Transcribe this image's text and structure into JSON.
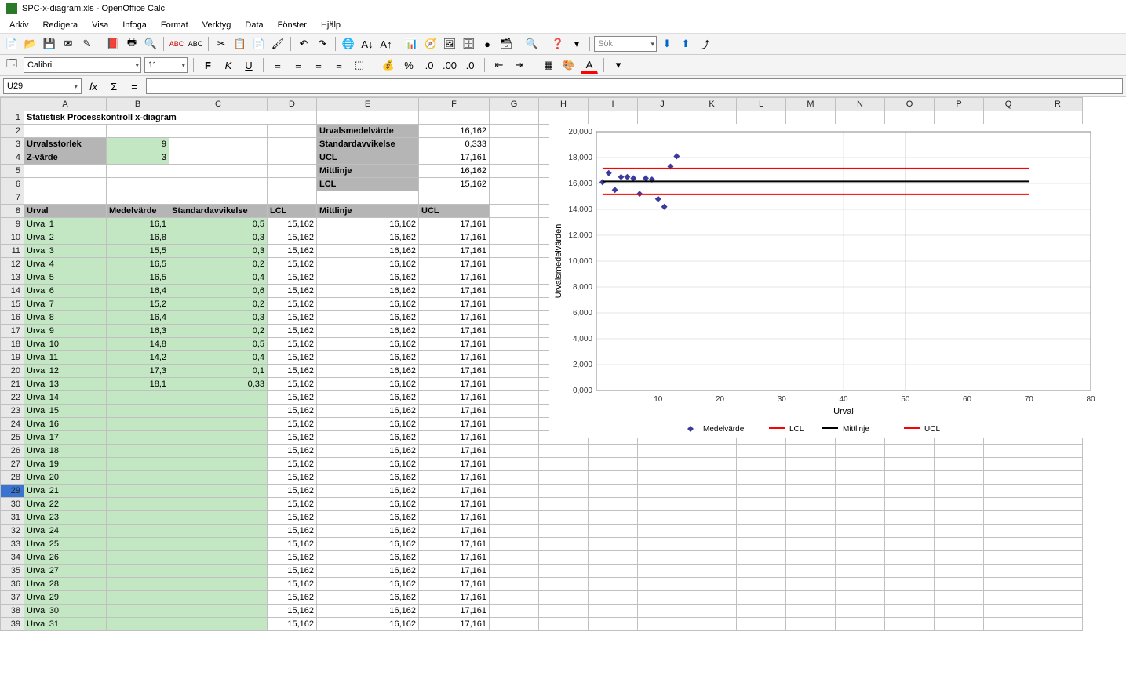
{
  "app": {
    "title": "SPC-x-diagram.xls - OpenOffice Calc"
  },
  "menu": {
    "arkiv": "Arkiv",
    "redigera": "Redigera",
    "visa": "Visa",
    "infoga": "Infoga",
    "format": "Format",
    "verktyg": "Verktyg",
    "data": "Data",
    "fonster": "Fönster",
    "hjalp": "Hjälp"
  },
  "font": {
    "name": "Calibri",
    "size": "11"
  },
  "search_placeholder": "Sök",
  "cell_ref": "U29",
  "formula": "",
  "colHeaders": [
    "A",
    "B",
    "C",
    "D",
    "E",
    "F",
    "G",
    "H",
    "I",
    "J",
    "K",
    "L",
    "M",
    "N",
    "O",
    "P",
    "Q",
    "R"
  ],
  "titleRow": "Statistisk Processkontroll x-diagram",
  "params": {
    "urvalsstorlek_label": "Urvalsstorlek",
    "urvalsstorlek_val": "9",
    "zvarde_label": "Z-värde",
    "zvarde_val": "3",
    "urvalsmedel_label": "Urvalsmedelvärde",
    "urvalsmedel_val": "16,162",
    "stdav_label": "Standardavvikelse",
    "stdav_val": "0,333",
    "ucl_label": "UCL",
    "ucl_val": "17,161",
    "mitt_label": "Mittlinje",
    "mitt_val": "16,162",
    "lcl_label": "LCL",
    "lcl_val": "15,162"
  },
  "headers": {
    "urval": "Urval",
    "medel": "Medelvärde",
    "std": "Standardavvikelse",
    "lcl": "LCL",
    "mitt": "Mittlinje",
    "ucl": "UCL"
  },
  "rows": [
    {
      "n": "Urval 1",
      "m": "16,1",
      "s": "0,5",
      "lcl": "15,162",
      "mitt": "16,162",
      "ucl": "17,161"
    },
    {
      "n": "Urval 2",
      "m": "16,8",
      "s": "0,3",
      "lcl": "15,162",
      "mitt": "16,162",
      "ucl": "17,161"
    },
    {
      "n": "Urval 3",
      "m": "15,5",
      "s": "0,3",
      "lcl": "15,162",
      "mitt": "16,162",
      "ucl": "17,161"
    },
    {
      "n": "Urval 4",
      "m": "16,5",
      "s": "0,2",
      "lcl": "15,162",
      "mitt": "16,162",
      "ucl": "17,161"
    },
    {
      "n": "Urval 5",
      "m": "16,5",
      "s": "0,4",
      "lcl": "15,162",
      "mitt": "16,162",
      "ucl": "17,161"
    },
    {
      "n": "Urval 6",
      "m": "16,4",
      "s": "0,6",
      "lcl": "15,162",
      "mitt": "16,162",
      "ucl": "17,161"
    },
    {
      "n": "Urval 7",
      "m": "15,2",
      "s": "0,2",
      "lcl": "15,162",
      "mitt": "16,162",
      "ucl": "17,161"
    },
    {
      "n": "Urval 8",
      "m": "16,4",
      "s": "0,3",
      "lcl": "15,162",
      "mitt": "16,162",
      "ucl": "17,161"
    },
    {
      "n": "Urval 9",
      "m": "16,3",
      "s": "0,2",
      "lcl": "15,162",
      "mitt": "16,162",
      "ucl": "17,161"
    },
    {
      "n": "Urval 10",
      "m": "14,8",
      "s": "0,5",
      "lcl": "15,162",
      "mitt": "16,162",
      "ucl": "17,161"
    },
    {
      "n": "Urval 11",
      "m": "14,2",
      "s": "0,4",
      "lcl": "15,162",
      "mitt": "16,162",
      "ucl": "17,161"
    },
    {
      "n": "Urval 12",
      "m": "17,3",
      "s": "0,1",
      "lcl": "15,162",
      "mitt": "16,162",
      "ucl": "17,161"
    },
    {
      "n": "Urval 13",
      "m": "18,1",
      "s": "0,33",
      "lcl": "15,162",
      "mitt": "16,162",
      "ucl": "17,161"
    },
    {
      "n": "Urval 14",
      "m": "",
      "s": "",
      "lcl": "15,162",
      "mitt": "16,162",
      "ucl": "17,161"
    },
    {
      "n": "Urval 15",
      "m": "",
      "s": "",
      "lcl": "15,162",
      "mitt": "16,162",
      "ucl": "17,161"
    },
    {
      "n": "Urval 16",
      "m": "",
      "s": "",
      "lcl": "15,162",
      "mitt": "16,162",
      "ucl": "17,161"
    },
    {
      "n": "Urval 17",
      "m": "",
      "s": "",
      "lcl": "15,162",
      "mitt": "16,162",
      "ucl": "17,161"
    },
    {
      "n": "Urval 18",
      "m": "",
      "s": "",
      "lcl": "15,162",
      "mitt": "16,162",
      "ucl": "17,161"
    },
    {
      "n": "Urval 19",
      "m": "",
      "s": "",
      "lcl": "15,162",
      "mitt": "16,162",
      "ucl": "17,161"
    },
    {
      "n": "Urval 20",
      "m": "",
      "s": "",
      "lcl": "15,162",
      "mitt": "16,162",
      "ucl": "17,161"
    },
    {
      "n": "Urval 21",
      "m": "",
      "s": "",
      "lcl": "15,162",
      "mitt": "16,162",
      "ucl": "17,161"
    },
    {
      "n": "Urval 22",
      "m": "",
      "s": "",
      "lcl": "15,162",
      "mitt": "16,162",
      "ucl": "17,161"
    },
    {
      "n": "Urval 23",
      "m": "",
      "s": "",
      "lcl": "15,162",
      "mitt": "16,162",
      "ucl": "17,161"
    },
    {
      "n": "Urval 24",
      "m": "",
      "s": "",
      "lcl": "15,162",
      "mitt": "16,162",
      "ucl": "17,161"
    },
    {
      "n": "Urval 25",
      "m": "",
      "s": "",
      "lcl": "15,162",
      "mitt": "16,162",
      "ucl": "17,161"
    },
    {
      "n": "Urval 26",
      "m": "",
      "s": "",
      "lcl": "15,162",
      "mitt": "16,162",
      "ucl": "17,161"
    },
    {
      "n": "Urval 27",
      "m": "",
      "s": "",
      "lcl": "15,162",
      "mitt": "16,162",
      "ucl": "17,161"
    },
    {
      "n": "Urval 28",
      "m": "",
      "s": "",
      "lcl": "15,162",
      "mitt": "16,162",
      "ucl": "17,161"
    },
    {
      "n": "Urval 29",
      "m": "",
      "s": "",
      "lcl": "15,162",
      "mitt": "16,162",
      "ucl": "17,161"
    },
    {
      "n": "Urval 30",
      "m": "",
      "s": "",
      "lcl": "15,162",
      "mitt": "16,162",
      "ucl": "17,161"
    },
    {
      "n": "Urval 31",
      "m": "",
      "s": "",
      "lcl": "15,162",
      "mitt": "16,162",
      "ucl": "17,161"
    }
  ],
  "chart_data": {
    "type": "scatter",
    "title": "",
    "xlabel": "Urval",
    "ylabel": "Urvalsmedelvärden",
    "xlim": [
      0,
      80
    ],
    "ylim": [
      0,
      20000
    ],
    "x_ticks": [
      0,
      10,
      20,
      30,
      40,
      50,
      60,
      70,
      80
    ],
    "y_ticks": [
      "0,000",
      "2,000",
      "4,000",
      "6,000",
      "8,000",
      "10,000",
      "12,000",
      "14,000",
      "16,000",
      "18,000",
      "20,000"
    ],
    "series": [
      {
        "name": "Medelvärde",
        "type": "scatter",
        "color": "#3b3b9e",
        "x": [
          1,
          2,
          3,
          4,
          5,
          6,
          7,
          8,
          9,
          10,
          11,
          12,
          13
        ],
        "y": [
          16.1,
          16.8,
          15.5,
          16.5,
          16.5,
          16.4,
          15.2,
          16.4,
          16.3,
          14.8,
          14.2,
          17.3,
          18.1
        ]
      },
      {
        "name": "LCL",
        "type": "line",
        "color": "#ff0000",
        "x": [
          1,
          70
        ],
        "y": [
          15.162,
          15.162
        ]
      },
      {
        "name": "Mittlinje",
        "type": "line",
        "color": "#000000",
        "x": [
          1,
          70
        ],
        "y": [
          16.162,
          16.162
        ]
      },
      {
        "name": "UCL",
        "type": "line",
        "color": "#ff0000",
        "x": [
          1,
          70
        ],
        "y": [
          17.161,
          17.161
        ]
      }
    ],
    "legend": [
      "Medelvärde",
      "LCL",
      "Mittlinje",
      "UCL"
    ]
  }
}
